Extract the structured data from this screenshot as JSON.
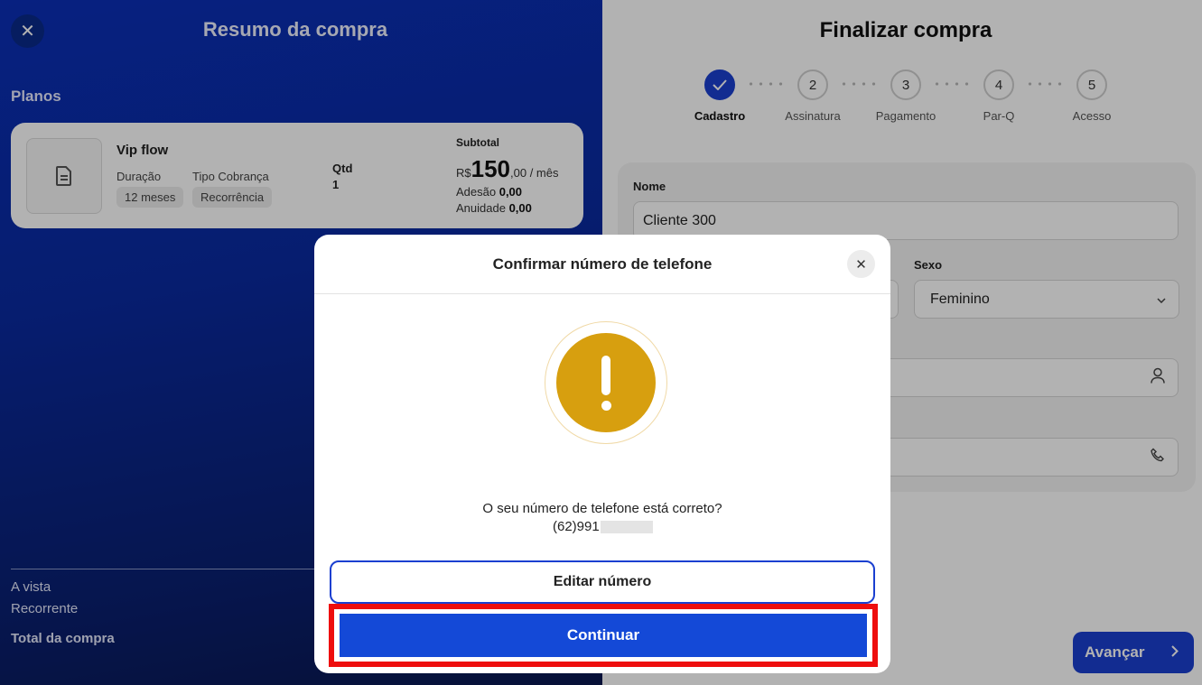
{
  "summary": {
    "title": "Resumo da compra",
    "section_label": "Planos",
    "plan": {
      "name": "Vip flow",
      "duration_label": "Duração",
      "duration_value": "12 meses",
      "billing_label": "Tipo Cobrança",
      "billing_value": "Recorrência",
      "qty_label": "Qtd",
      "qty_value": "1",
      "subtotal_label": "Subtotal",
      "currency": "R$",
      "price_int": "150",
      "price_rest": ",00 / mês",
      "adesao_label": "Adesão",
      "adesao_value": "0,00",
      "anuidade_label": "Anuidade",
      "anuidade_value": "0,00"
    },
    "totals": {
      "a_vista": "A vista",
      "recorrente": "Recorrente",
      "total": "Total da compra"
    }
  },
  "checkout": {
    "title": "Finalizar compra",
    "steps": [
      {
        "num": "1",
        "label": "Cadastro",
        "done": true
      },
      {
        "num": "2",
        "label": "Assinatura"
      },
      {
        "num": "3",
        "label": "Pagamento"
      },
      {
        "num": "4",
        "label": "Par-Q"
      },
      {
        "num": "5",
        "label": "Acesso"
      }
    ],
    "form": {
      "name_label": "Nome",
      "name_value": "Cliente 300",
      "sexo_label": "Sexo",
      "sexo_value": "Feminino"
    },
    "next_button": "Avançar"
  },
  "modal": {
    "title": "Confirmar número de telefone",
    "question": "O seu número de telefone está correto?",
    "phone_visible": "(62)991",
    "edit_button": "Editar número",
    "continue_button": "Continuar"
  },
  "colors": {
    "primary": "#1a3fd0",
    "warning": "#d79f0f",
    "highlight": "#ee0e0e"
  }
}
